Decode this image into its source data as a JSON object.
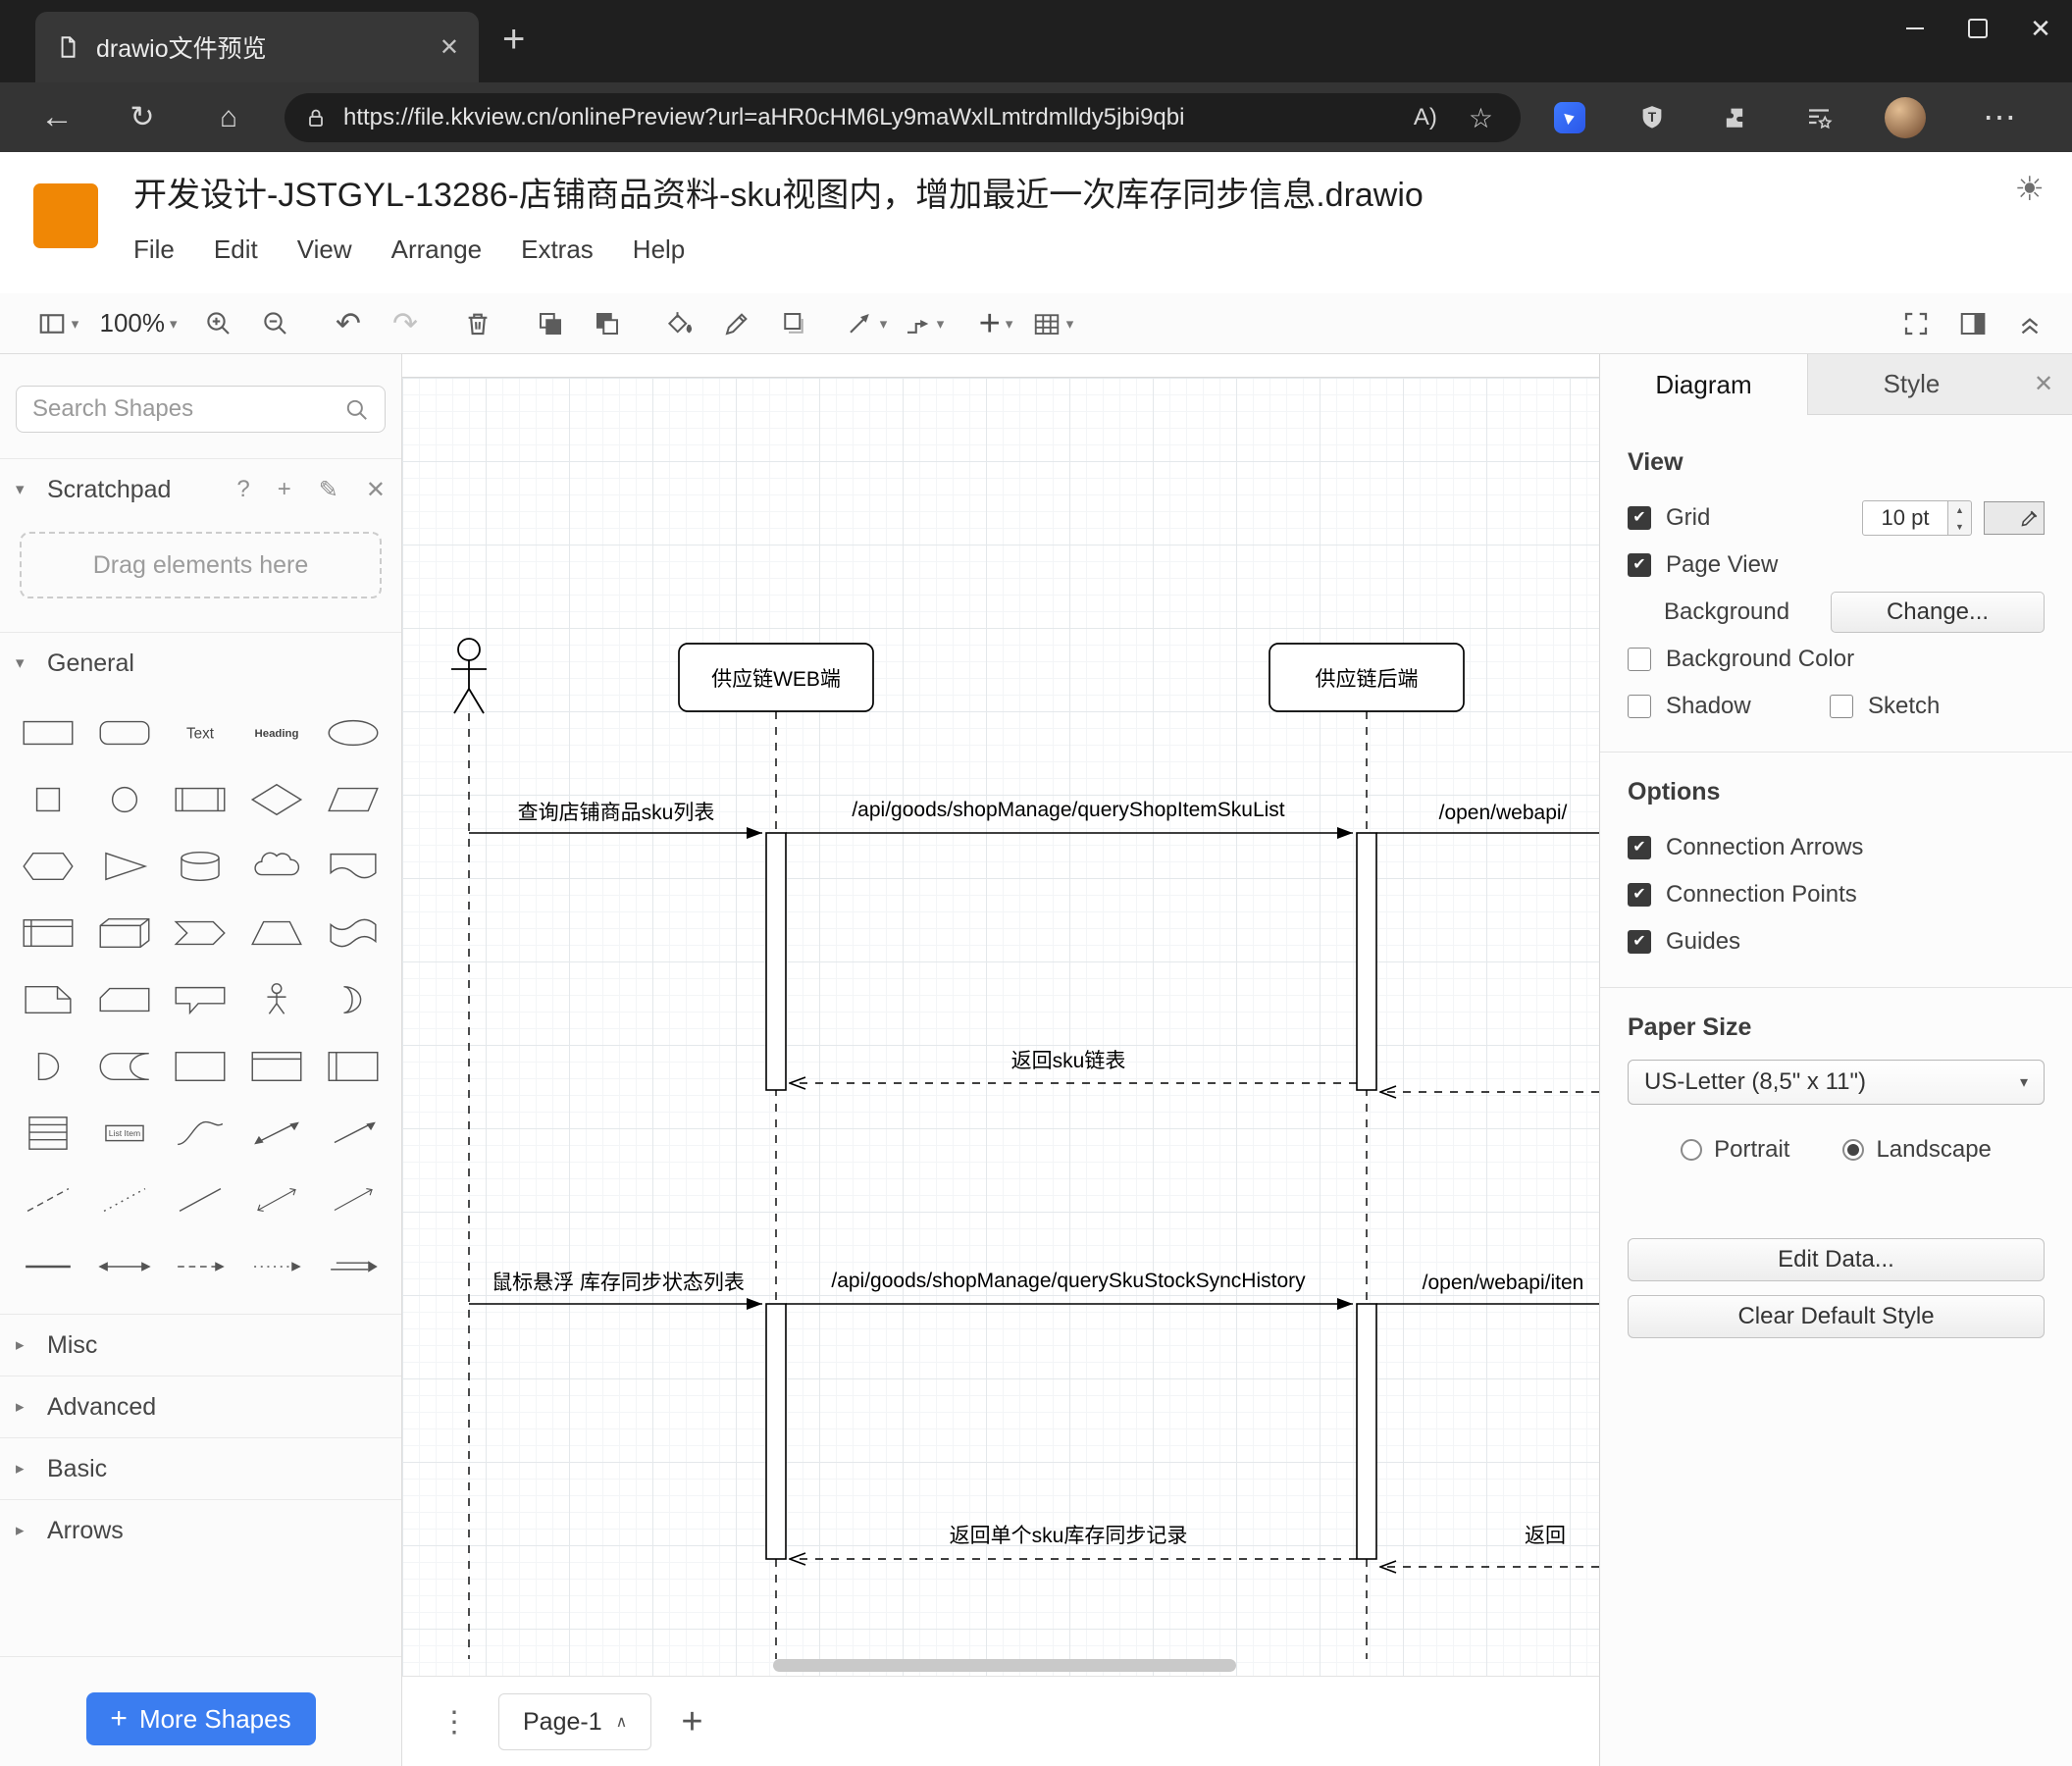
{
  "icons": {
    "close": "✕",
    "plus": "+",
    "back": "←",
    "refresh": "↻",
    "home": "⌂",
    "star": "☆",
    "more": "⋯",
    "dots": "⋮",
    "sun": "☀",
    "caret_down": "▾",
    "caret_right": "▸",
    "check": "✔",
    "page_caret": "∧",
    "question": "?",
    "pencil": "✎",
    "read_aloud": "A)",
    "undo": "↶",
    "redo": "↷",
    "up": "▲",
    "down": "▼"
  },
  "browser": {
    "tab_title": "drawio文件预览",
    "url": "https://file.kkview.cn/onlinePreview?url=aHR0cHM6Ly9maWxlLmtrdmlldy5jbi9qbi"
  },
  "app": {
    "title": "开发设计-JSTGYL-13286-店铺商品资料-sku视图内，增加最近一次库存同步信息.drawio",
    "menu": [
      "File",
      "Edit",
      "View",
      "Arrange",
      "Extras",
      "Help"
    ],
    "zoom_level": "100%"
  },
  "sidebar": {
    "search_placeholder": "Search Shapes",
    "scratchpad": "Scratchpad",
    "drag_hint": "Drag elements here",
    "sections": {
      "general": "General",
      "misc": "Misc",
      "advanced": "Advanced",
      "basic": "Basic",
      "arrows": "Arrows"
    },
    "more_shapes": "More Shapes",
    "shape_labels": {
      "text": "Text",
      "heading": "Heading",
      "list_item": "List Item"
    },
    "shapes": [
      "rectangle",
      "rounded-rectangle",
      "text",
      "heading",
      "ellipse",
      "square",
      "circle",
      "process",
      "diamond",
      "parallelogram",
      "hexagon",
      "triangle",
      "cylinder",
      "cloud",
      "document",
      "internal-storage",
      "cube",
      "step",
      "trapezoid",
      "tape",
      "note",
      "card",
      "callout",
      "actor",
      "or",
      "and",
      "data-storage",
      "container",
      "vertical-container",
      "horizontal-container",
      "list",
      "list-item",
      "curve",
      "bidirectional-arrow",
      "arrow",
      "dashed-line",
      "dotted-line",
      "line",
      "bidirectional-connector",
      "directional-connector",
      "horizontal-line",
      "double-arrow",
      "dashed-arrow",
      "dotted-arrow",
      "link"
    ]
  },
  "canvas": {
    "page_tab": "Page-1",
    "diagram": {
      "participants": [
        "供应链WEB端",
        "供应链后端"
      ],
      "messages": {
        "m1": "查询店铺商品sku列表",
        "m2": "/api/goods/shopManage/queryShopItemSkuList",
        "m3": "/open/webapi/",
        "r1": "返回sku链表",
        "m4": "鼠标悬浮 库存同步状态列表",
        "m5": "/api/goods/shopManage/querySkuStockSyncHistory",
        "m6": "/open/webapi/iten",
        "r2": "返回单个sku库存同步记录",
        "r3": "返回"
      }
    }
  },
  "panel": {
    "tabs": {
      "diagram": "Diagram",
      "style": "Style"
    },
    "view": {
      "heading": "View",
      "grid": "Grid",
      "grid_size": "10 pt",
      "page_view": "Page View",
      "background": "Background",
      "change": "Change...",
      "background_color": "Background Color",
      "shadow": "Shadow",
      "sketch": "Sketch"
    },
    "options": {
      "heading": "Options",
      "connection_arrows": "Connection Arrows",
      "connection_points": "Connection Points",
      "guides": "Guides"
    },
    "paper": {
      "heading": "Paper Size",
      "size": "US-Letter (8,5\" x 11\")",
      "portrait": "Portrait",
      "landscape": "Landscape"
    },
    "buttons": {
      "edit_data": "Edit Data...",
      "clear_default_style": "Clear Default Style"
    }
  },
  "colors": {
    "accent_blue": "#3b7df0",
    "logo_orange": "#f08705"
  }
}
